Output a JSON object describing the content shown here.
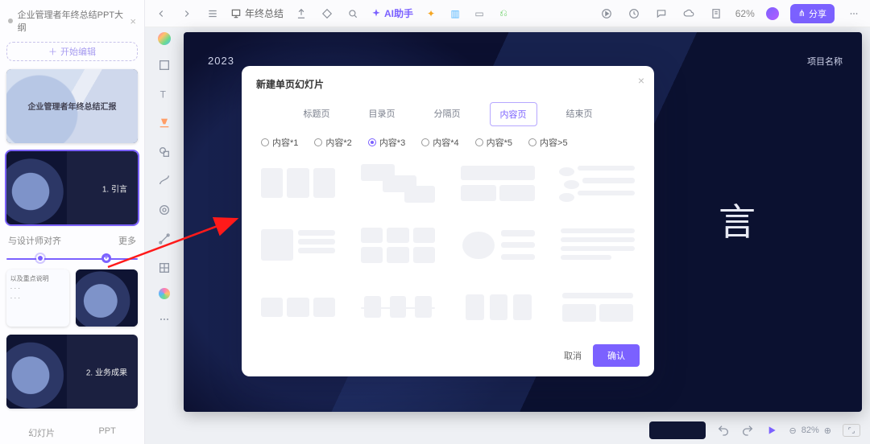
{
  "doc": {
    "name": "企业管理者年终总结PPT大纲"
  },
  "left": {
    "add_panel": "开始编辑",
    "group_label": "与设计师对齐",
    "group_more": "更多",
    "thumb1_caption": "企业管理者年终总结汇报",
    "thumb2_caption": "1. 引言",
    "thumb3_lines": "以及重点说明",
    "thumb4_caption": "2. 业务成果",
    "footer_left": "幻灯片",
    "footer_right": "PPT"
  },
  "topbar": {
    "doc_button": "年终总结",
    "ai": "AI助手",
    "zoom": "62%",
    "share": "分享"
  },
  "slide": {
    "year": "2023",
    "project": "项目名称",
    "headline_visible": "言"
  },
  "bottombar": {
    "zoom": "82%"
  },
  "modal": {
    "title": "新建单页幻灯片",
    "tabs": [
      "标题页",
      "目录页",
      "分隔页",
      "内容页",
      "结束页"
    ],
    "selected_tab_index": 3,
    "radios": [
      "内容*1",
      "内容*2",
      "内容*3",
      "内容*4",
      "内容*5",
      "内容>5"
    ],
    "selected_radio_index": 2,
    "cancel": "取消",
    "ok": "确认"
  }
}
